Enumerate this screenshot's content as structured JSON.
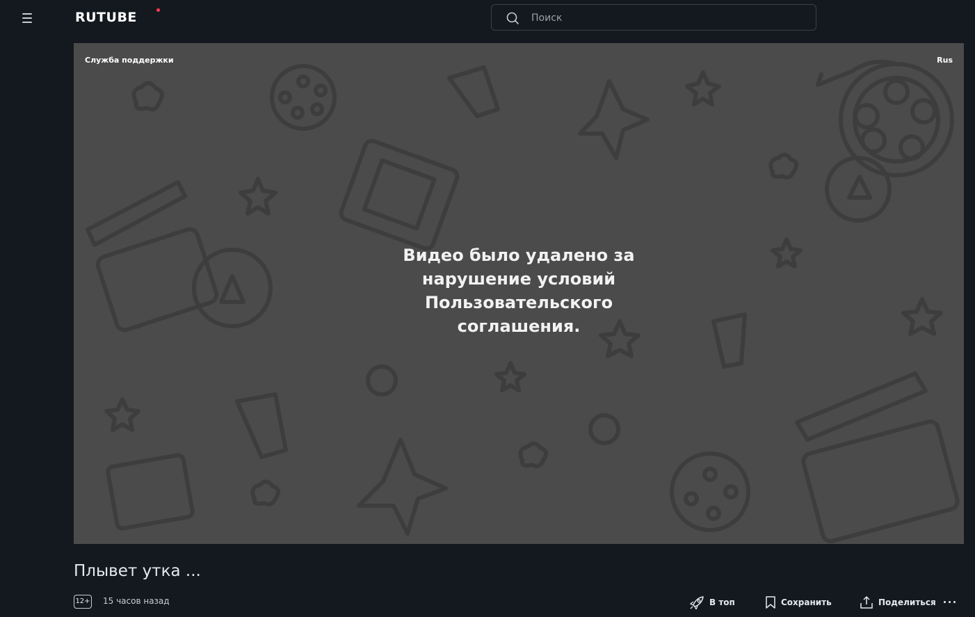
{
  "header": {
    "logo_text": "RUTUBE",
    "search_placeholder": "Поиск"
  },
  "player": {
    "support_link": "Служба поддержки",
    "language": "Rus",
    "message": "Видео было удалено за нарушение условий Пользовательского соглашения."
  },
  "video": {
    "title": "Плывет утка ...",
    "age_rating": "12+",
    "published": "15 часов назад"
  },
  "actions": {
    "top_label": "В топ",
    "save_label": "Сохранить",
    "share_label": "Поделиться"
  },
  "colors": {
    "page_bg": "#14191f",
    "player_bg": "#4b4b4b",
    "logo_dot": "#ff3a52"
  }
}
